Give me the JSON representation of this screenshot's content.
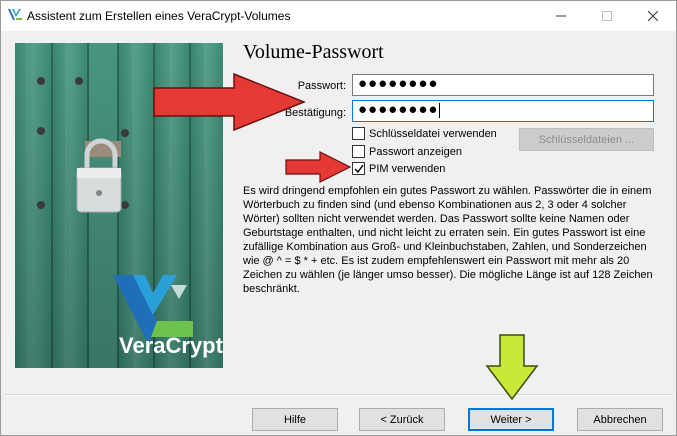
{
  "window": {
    "title": "Assistent zum Erstellen eines VeraCrypt-Volumes"
  },
  "sidepanel": {
    "logo_text": "VeraCrypt"
  },
  "page": {
    "title": "Volume-Passwort"
  },
  "form": {
    "password_label": "Passwort:",
    "password_value": "●●●●●●●●",
    "confirm_label": "Bestätigung:",
    "confirm_value": "●●●●●●●●",
    "keyfile_checkbox": {
      "label": "Schlüsseldatei verwenden",
      "checked": false
    },
    "show_password_checkbox": {
      "label": "Passwort anzeigen",
      "checked": false
    },
    "pim_checkbox": {
      "label": "PIM verwenden",
      "checked": true
    },
    "keyfiles_button": "Schlüsseldateien ...",
    "keyfiles_button_enabled": false
  },
  "info_text": "Es wird dringend empfohlen ein gutes Passwort zu wählen. Passwörter die in einem Wörterbuch zu finden sind (und ebenso Kombinationen aus 2, 3 oder 4 solcher Wörter) sollten nicht verwendet werden. Das Passwort sollte keine Namen oder Geburtstage enthalten, und nicht leicht zu erraten sein. Ein gutes Passwort ist eine zufällige Kombination aus Groß- und Kleinbuchstaben, Zahlen, und Sonderzeichen wie @ ^ = $ * + etc. Es ist zudem empfehlenswert ein Passwort mit mehr als 20 Zeichen zu wählen (je länger umso besser). Die mögliche Länge ist auf 128 Zeichen beschränkt.",
  "buttons": {
    "help": "Hilfe",
    "back": "< Zurück",
    "next": "Weiter >",
    "cancel": "Abbrechen"
  },
  "icons": {
    "app": "veracrypt-app-icon",
    "minimize": "minimize-icon",
    "maximize": "maximize-icon",
    "close": "close-icon",
    "checkmark": "checkmark-icon"
  },
  "colors": {
    "accent": "#0078d7",
    "annotation_red": "#e53935",
    "annotation_green": "#c8e83a",
    "veracrypt_blue": "#1e6fb7"
  }
}
